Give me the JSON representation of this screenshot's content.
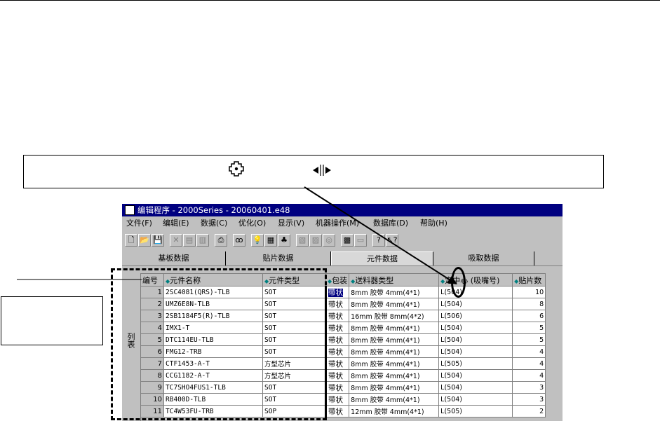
{
  "window": {
    "title": "编辑程序  - 2000Series - 20060401.e48"
  },
  "menu": [
    "文件(F)",
    "编辑(E)",
    "数据(C)",
    "优化(O)",
    "显示(V)",
    "机器操作(M)",
    "数据库(D)",
    "帮助(H)"
  ],
  "toolbar": {
    "icons": [
      "new-file-icon",
      "open-folder-icon",
      "save-icon",
      "delete-icon",
      "copy-icon",
      "paste-icon",
      "print-icon",
      "find-icon",
      "optimize-icon",
      "color-icon",
      "nozzle-icon",
      "machine-icon",
      "feeder-icon",
      "camera-icon",
      "compile-icon",
      "panel-icon",
      "help-icon",
      "context-help-icon"
    ],
    "labels": [
      "🗋",
      "📂",
      "💾",
      "✕",
      "▤",
      "▥",
      "⎙",
      "ꝏ",
      "💡",
      "▦",
      "♣",
      "▧",
      "▨",
      "◎",
      "▩",
      "▭",
      "?",
      "↖?"
    ]
  },
  "tabs": [
    "基板数据",
    "贴片数据",
    "元件数据",
    "吸取数据"
  ],
  "active_tab": 2,
  "grid": {
    "row_label": "列表",
    "columns": [
      "编号",
      "元件名称",
      "元件类型",
      "包装",
      "送料器类型",
      "定中心 (吸嘴号)",
      "贴片数"
    ],
    "sort_columns": [
      1,
      2,
      3,
      4,
      5,
      6
    ],
    "rows": [
      {
        "no": "1",
        "name": "2SC4081(QRS)-TLB",
        "type": "SOT",
        "pkg": "带状",
        "feeder": "8mm  胶带    4mm(4*1)",
        "center": "L(504)",
        "count": "10"
      },
      {
        "no": "2",
        "name": "UMZ6E8N-TLB",
        "type": "SOT",
        "pkg": "带状",
        "feeder": "8mm  胶带    4mm(4*1)",
        "center": "L(504)",
        "count": "8"
      },
      {
        "no": "3",
        "name": "2SB1184F5(R)-TLB",
        "type": "SOT",
        "pkg": "带状",
        "feeder": "16mm  胶带    8mm(4*2)",
        "center": "L(506)",
        "count": "6"
      },
      {
        "no": "4",
        "name": "IMX1-T",
        "type": "SOT",
        "pkg": "带状",
        "feeder": "8mm  胶带    4mm(4*1)",
        "center": "L(504)",
        "count": "5"
      },
      {
        "no": "5",
        "name": "DTC114EU-TLB",
        "type": "SOT",
        "pkg": "带状",
        "feeder": "8mm  胶带    4mm(4*1)",
        "center": "L(504)",
        "count": "5"
      },
      {
        "no": "6",
        "name": "FMG12-TRB",
        "type": "SOT",
        "pkg": "带状",
        "feeder": "8mm  胶带    4mm(4*1)",
        "center": "L(504)",
        "count": "4"
      },
      {
        "no": "7",
        "name": "CTF1453-A-T",
        "type": "方型芯片",
        "pkg": "带状",
        "feeder": "8mm  胶带    4mm(4*1)",
        "center": "L(505)",
        "count": "4"
      },
      {
        "no": "8",
        "name": "CCG1182-A-T",
        "type": "方型芯片",
        "pkg": "带状",
        "feeder": "8mm  胶带    4mm(4*1)",
        "center": "L(504)",
        "count": "4"
      },
      {
        "no": "9",
        "name": "TC7SHO4FUS1-TLB",
        "type": "SOT",
        "pkg": "带状",
        "feeder": "8mm  胶带    4mm(4*1)",
        "center": "L(504)",
        "count": "3"
      },
      {
        "no": "10",
        "name": "RB400D-TLB",
        "type": "SOT",
        "pkg": "带状",
        "feeder": "8mm  胶带    4mm(4*1)",
        "center": "L(504)",
        "count": "3"
      },
      {
        "no": "11",
        "name": "TC4W53FU-TRB",
        "type": "SOP",
        "pkg": "带状",
        "feeder": "12mm  胶带    4mm(4*1)",
        "center": "L(505)",
        "count": "2"
      }
    ]
  },
  "callout": {
    "icons": [
      "move-cursor-icon",
      "column-resize-cursor-icon"
    ]
  },
  "colors": {
    "titlebar": "#000080",
    "window_face": "#c0c0c0",
    "sort_marker": "#008080"
  }
}
